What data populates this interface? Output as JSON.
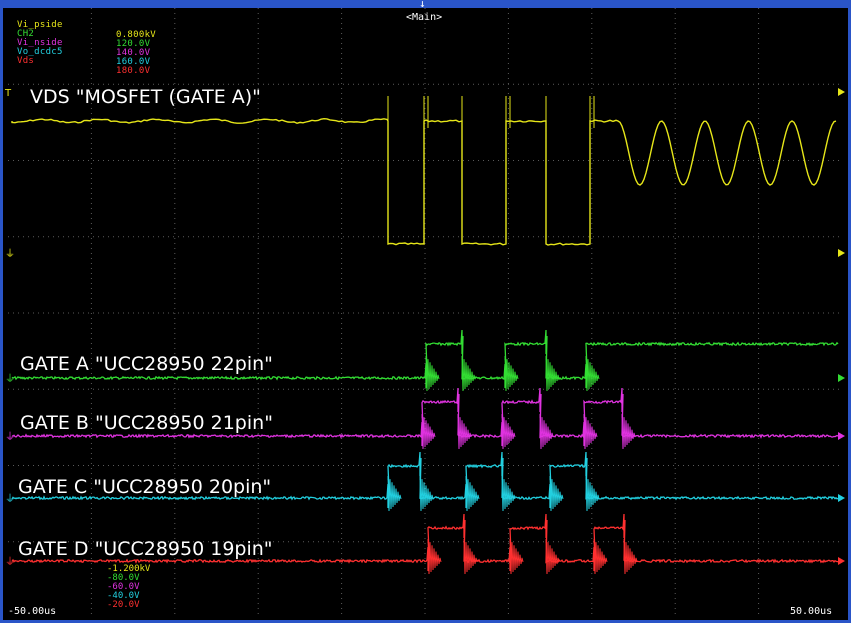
{
  "screen": {
    "tab_label": "<Main>",
    "trigger_marker": "↓",
    "time_left": "-50.00us",
    "time_right": "50.00us"
  },
  "legend": [
    {
      "name": "Vi_pside",
      "value": "0.800kV",
      "color": "#e6e619"
    },
    {
      "name": "CH2",
      "value": "120.0V",
      "color": "#33dd33"
    },
    {
      "name": "Vi_nside",
      "value": "140.0V",
      "color": "#e033e0"
    },
    {
      "name": "Vo_dcdc5",
      "value": "160.0V",
      "color": "#22d0e0"
    },
    {
      "name": "Vds",
      "value": "180.0V",
      "color": "#ff3030"
    }
  ],
  "scale_offsets": [
    {
      "value": "-1.200kV",
      "color": "#e6e619"
    },
    {
      "value": "-80.0V",
      "color": "#33dd33"
    },
    {
      "value": "-60.0V",
      "color": "#e033e0"
    },
    {
      "value": "-40.0V",
      "color": "#22d0e0"
    },
    {
      "value": "-20.0V",
      "color": "#ff3030"
    }
  ],
  "annotations": {
    "vds": "VDS \"MOSFET (GATE A)\"",
    "gate_a": "GATE A \"UCC28950 22pin\"",
    "gate_b": "GATE B \"UCC28950 21pin\"",
    "gate_c": "GATE C \"UCC28950 20pin\"",
    "gate_d": "GATE D \"UCC28950 19pin\""
  },
  "colors": {
    "ch1": "#e6e619",
    "ch2": "#33dd33",
    "ch3": "#e033e0",
    "ch4": "#22d0e0",
    "ch5": "#ff3030",
    "grid": "#5a5a5a",
    "frame": "#2a55c8"
  }
}
